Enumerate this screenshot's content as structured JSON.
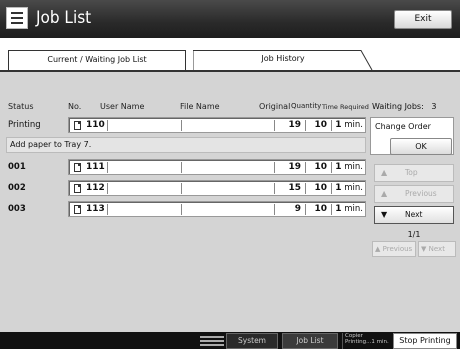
{
  "titlebar": {
    "title": "Job List",
    "icon": "job-list-icon",
    "exit_label": "Exit"
  },
  "tabs": [
    {
      "label": "Current / Waiting Job List",
      "active": true
    },
    {
      "label": "Job History",
      "active": false
    }
  ],
  "columns": {
    "status": "Status",
    "no": "No.",
    "user_name": "User Name",
    "file_name": "File Name",
    "original": "Original",
    "quantity": "Quantity",
    "time_required": "Time Required"
  },
  "jobs": [
    {
      "status": "Printing",
      "no": "110",
      "user_name": "",
      "file_name": "",
      "original": "19",
      "quantity": "10",
      "time_value": "1",
      "time_unit": "min."
    },
    {
      "status": "001",
      "no": "111",
      "user_name": "",
      "file_name": "",
      "original": "19",
      "quantity": "10",
      "time_value": "1",
      "time_unit": "min."
    },
    {
      "status": "002",
      "no": "112",
      "user_name": "",
      "file_name": "",
      "original": "15",
      "quantity": "10",
      "time_value": "1",
      "time_unit": "min."
    },
    {
      "status": "003",
      "no": "113",
      "user_name": "",
      "file_name": "",
      "original": "9",
      "quantity": "10",
      "time_value": "1",
      "time_unit": "min."
    }
  ],
  "notice": "Add paper to Tray 7.",
  "side": {
    "waiting_label": "Waiting Jobs:",
    "waiting_count": "3",
    "change_order": "Change Order",
    "ok": "OK",
    "top": "Top",
    "previous": "Previous",
    "next": "Next",
    "page": "1/1",
    "prev_page": "Previous",
    "next_page": "Next"
  },
  "statusbar": {
    "system_status": "System Status",
    "job_list": "Job List",
    "copier_line1": "Copier",
    "copier_line2": "Printing...1 min.",
    "stop_printing": "Stop Printing"
  },
  "colors": {
    "titlebar": "#2a2a2a",
    "content": "#d4d4d4",
    "statusbar": "#111111"
  }
}
